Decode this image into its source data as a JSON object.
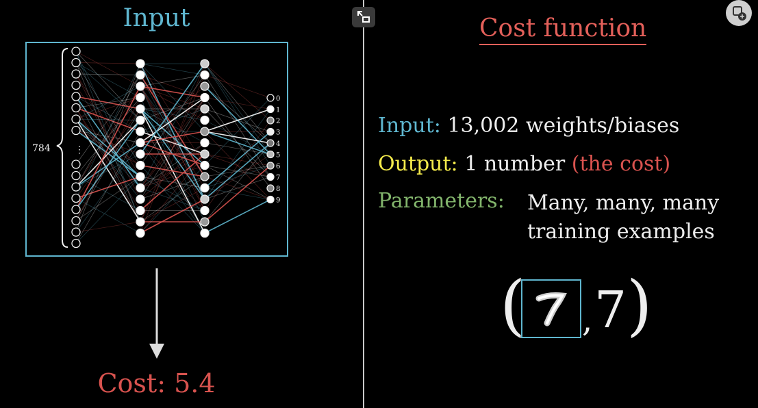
{
  "left_panel": {
    "title": "Input",
    "input_count_label": "784",
    "output_digits": [
      "0",
      "1",
      "2",
      "3",
      "4",
      "5",
      "6",
      "7",
      "8",
      "9"
    ],
    "cost_label": "Cost: 5.4"
  },
  "right_panel": {
    "title": "Cost function",
    "rows": [
      {
        "label": "Input:",
        "value": "13,002 weights/biases"
      },
      {
        "label": "Output:",
        "value": "1 number",
        "note": "(the cost)"
      },
      {
        "label": "Parameters:",
        "value_lines": [
          "Many, many, many",
          "training examples"
        ]
      }
    ],
    "example_tuple": {
      "open": "(",
      "label": "7",
      "comma": ",",
      "close": ")"
    }
  },
  "icons": {
    "fullscreen": "exit-fullscreen-icon",
    "settings": "overlay-settings-icon"
  },
  "colors": {
    "blue": "#5fb6cf",
    "red": "#d9534f",
    "yellow": "#f3ea4b",
    "green": "#82b46c"
  }
}
